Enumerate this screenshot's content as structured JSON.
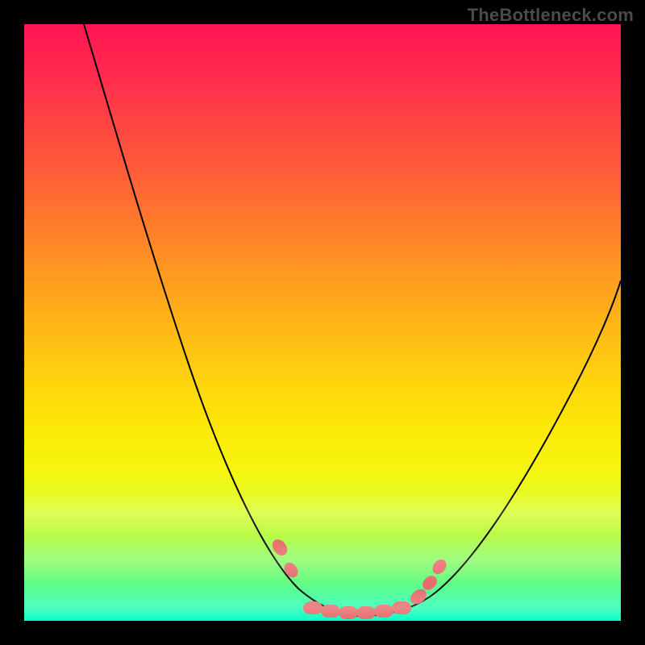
{
  "watermark": {
    "text": "TheBottleneck.com"
  },
  "colors": {
    "curve_stroke": "#000000",
    "link_fill": "#e86a6a",
    "link_stroke": "#c94f4f"
  },
  "chart_data": {
    "type": "line",
    "title": "",
    "xlabel": "",
    "ylabel": "",
    "xlim": [
      0,
      100
    ],
    "ylim": [
      0,
      100
    ],
    "grid": false,
    "legend": false,
    "note": "Bottleneck-style V curve; y is mismatch percentage (0 = no bottleneck). Two thin black curves descend from top-left and top-right and meet in a flat trough around x 47–63. Salmon sausage-link markers sit along the trough and short climbs.",
    "series": [
      {
        "name": "left-curve",
        "x": [
          10,
          14,
          18,
          22,
          26,
          30,
          34,
          38,
          42,
          45,
          48,
          50,
          53,
          56
        ],
        "y": [
          100,
          90,
          80,
          69,
          58,
          47,
          37,
          27,
          18,
          11,
          5,
          2,
          0.7,
          0.4
        ]
      },
      {
        "name": "right-curve",
        "x": [
          56,
          60,
          64,
          68,
          72,
          76,
          80,
          84,
          88,
          92,
          96,
          100
        ],
        "y": [
          0.4,
          0.7,
          2,
          5,
          10,
          17,
          24,
          31,
          38,
          45,
          51,
          57
        ]
      }
    ],
    "markers": {
      "name": "sausage-links",
      "style": "rounded-capsule",
      "color": "#e86a6a",
      "positions_xy": [
        [
          42.5,
          12
        ],
        [
          44.5,
          8
        ],
        [
          47.5,
          3.5
        ],
        [
          50,
          2.3
        ],
        [
          52.5,
          1.7
        ],
        [
          55,
          1.4
        ],
        [
          57.5,
          1.4
        ],
        [
          60,
          1.7
        ],
        [
          62.5,
          2.3
        ],
        [
          65,
          3.7
        ],
        [
          67,
          6
        ],
        [
          68.5,
          9
        ]
      ]
    }
  }
}
